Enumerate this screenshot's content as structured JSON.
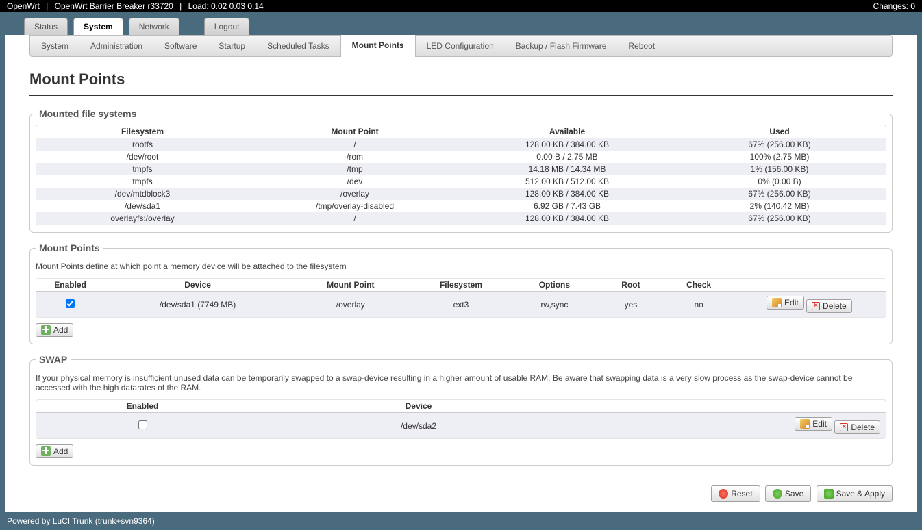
{
  "topbar": {
    "host": "OpenWrt",
    "sep": "|",
    "version": "OpenWrt Barrier Breaker r33720",
    "load_label": "Load: 0.02 0.03 0.14",
    "changes_label": "Changes: 0"
  },
  "tabs": {
    "status": "Status",
    "system": "System",
    "network": "Network",
    "logout": "Logout"
  },
  "subtabs": {
    "system": "System",
    "administration": "Administration",
    "software": "Software",
    "startup": "Startup",
    "scheduled": "Scheduled Tasks",
    "mount": "Mount Points",
    "led": "LED Configuration",
    "backup": "Backup / Flash Firmware",
    "reboot": "Reboot"
  },
  "page": {
    "title": "Mount Points"
  },
  "mounted": {
    "legend": "Mounted file systems",
    "headers": {
      "fs": "Filesystem",
      "mp": "Mount Point",
      "avail": "Available",
      "used": "Used"
    },
    "rows": [
      {
        "fs": "rootfs",
        "mp": "/",
        "avail": "128.00 KB / 384.00 KB",
        "used": "67% (256.00 KB)"
      },
      {
        "fs": "/dev/root",
        "mp": "/rom",
        "avail": "0.00 B / 2.75 MB",
        "used": "100% (2.75 MB)"
      },
      {
        "fs": "tmpfs",
        "mp": "/tmp",
        "avail": "14.18 MB / 14.34 MB",
        "used": "1% (156.00 KB)"
      },
      {
        "fs": "tmpfs",
        "mp": "/dev",
        "avail": "512.00 KB / 512.00 KB",
        "used": "0% (0.00 B)"
      },
      {
        "fs": "/dev/mtdblock3",
        "mp": "/overlay",
        "avail": "128.00 KB / 384.00 KB",
        "used": "67% (256.00 KB)"
      },
      {
        "fs": "/dev/sda1",
        "mp": "/tmp/overlay-disabled",
        "avail": "6.92 GB / 7.43 GB",
        "used": "2% (140.42 MB)"
      },
      {
        "fs": "overlayfs:/overlay",
        "mp": "/",
        "avail": "128.00 KB / 384.00 KB",
        "used": "67% (256.00 KB)"
      }
    ]
  },
  "mountpoints": {
    "legend": "Mount Points",
    "desc": "Mount Points define at which point a memory device will be attached to the filesystem",
    "headers": {
      "enabled": "Enabled",
      "device": "Device",
      "mp": "Mount Point",
      "fs": "Filesystem",
      "options": "Options",
      "root": "Root",
      "check": "Check"
    },
    "row": {
      "device": "/dev/sda1 (7749 MB)",
      "mp": "/overlay",
      "fs": "ext3",
      "options": "rw,sync",
      "root": "yes",
      "check": "no"
    },
    "edit": "Edit",
    "delete": "Delete",
    "add": "Add"
  },
  "swap": {
    "legend": "SWAP",
    "desc": "If your physical memory is insufficient unused data can be temporarily swapped to a swap-device resulting in a higher amount of usable RAM. Be aware that swapping data is a very slow process as the swap-device cannot be accessed with the high datarates of the RAM.",
    "headers": {
      "enabled": "Enabled",
      "device": "Device"
    },
    "row": {
      "device": "/dev/sda2"
    },
    "edit": "Edit",
    "delete": "Delete",
    "add": "Add"
  },
  "actions": {
    "reset": "Reset",
    "save": "Save",
    "apply": "Save & Apply"
  },
  "footer": "Powered by LuCI Trunk (trunk+svn9364)"
}
